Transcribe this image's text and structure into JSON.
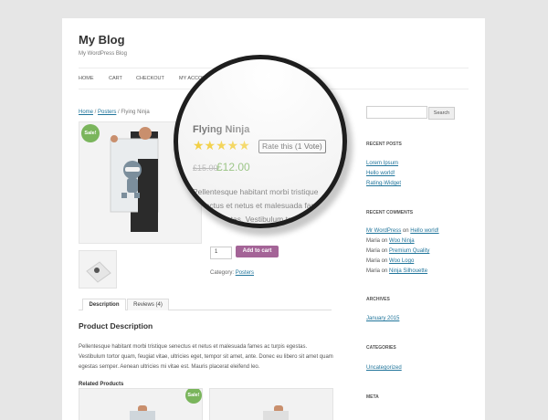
{
  "site": {
    "title": "My Blog",
    "description": "My WordPress Blog"
  },
  "nav": {
    "items": [
      "HOME",
      "CART",
      "CHECKOUT",
      "MY ACCOUNT"
    ]
  },
  "breadcrumb": {
    "home": "Home",
    "sep1": " / ",
    "posters": "Posters",
    "sep2": " / ",
    "current": "Flying Ninja"
  },
  "product": {
    "sale_badge": "Sale!",
    "title": "Flying Ninja",
    "rating": {
      "stars": "★★★★★",
      "rate_label": "Rate this (1 Vote)",
      "value": 5,
      "max": 5
    },
    "old_price": "£15.00",
    "price": "£12.00",
    "short_description": "Pellentesque habitant morbi tristique senectus et netus et malesuada fames ac turpis egestas. Vestibulum tortor quam, feugiat vitae, ultricies eget, tempor sit amet, ante. Donec eu libero sit amet quam egestas semper. Aenean ultricies mi vitae est. Mauris placerat eleifend leo.",
    "quantity": "1",
    "add_to_cart": "Add to cart",
    "category_label": "Category:",
    "category": "Posters"
  },
  "tabs": [
    "Description",
    "Reviews (4)"
  ],
  "description": {
    "title": "Product Description",
    "body": "Pellentesque habitant morbi tristique senectus et netus et malesuada fames ac turpis egestas. Vestibulum tortor quam, feugiat vitae, ultricies eget, tempor sit amet, ante. Donec eu libero sit amet quam egestas semper. Aenean ultricies mi vitae est. Mauris placerat eleifend leo."
  },
  "related": {
    "title": "Related Products",
    "sale_badge": "Sale!"
  },
  "sidebar": {
    "search_button": "Search",
    "recent_posts": {
      "title": "RECENT POSTS",
      "items": [
        "Lorem Ipsum",
        "Hello world!",
        "Rating-Widget"
      ]
    },
    "recent_comments": {
      "title": "RECENT COMMENTS",
      "items": [
        {
          "author": "Mr WordPress",
          "on": " on ",
          "post": "Hello world!"
        },
        {
          "author": "Maria",
          "on": " on ",
          "post": "Woo Ninja"
        },
        {
          "author": "Maria",
          "on": " on ",
          "post": "Premium Quality"
        },
        {
          "author": "Maria",
          "on": " on ",
          "post": "Woo Logo"
        },
        {
          "author": "Maria",
          "on": " on ",
          "post": "Ninja Silhouette"
        }
      ]
    },
    "archives": {
      "title": "ARCHIVES",
      "items": [
        "January 2015"
      ]
    },
    "categories": {
      "title": "CATEGORIES",
      "items": [
        "Uncategorized"
      ]
    },
    "meta": {
      "title": "META"
    }
  },
  "colors": {
    "accent": "#a46497",
    "sale": "#7ab55c",
    "link": "#21759b",
    "star": "#f5c400"
  },
  "icons": {
    "magnifier": "magnifying-glass-overlay"
  }
}
